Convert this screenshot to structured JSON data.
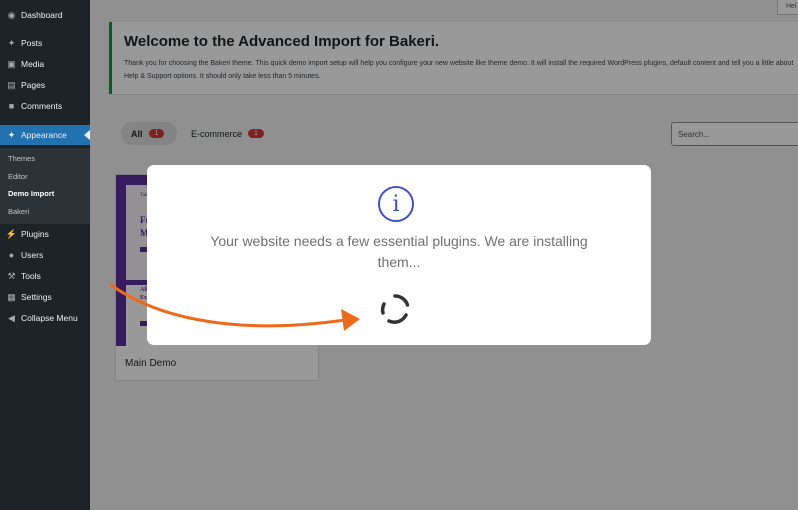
{
  "sidebar": {
    "items": [
      {
        "label": "Dashboard",
        "icon": "dashboard-icon"
      },
      {
        "label": "Posts",
        "icon": "pin-icon"
      },
      {
        "label": "Media",
        "icon": "media-icon"
      },
      {
        "label": "Pages",
        "icon": "pages-icon"
      },
      {
        "label": "Comments",
        "icon": "comments-icon"
      },
      {
        "label": "Appearance",
        "icon": "brush-icon"
      },
      {
        "label": "Plugins",
        "icon": "plug-icon"
      },
      {
        "label": "Users",
        "icon": "user-icon"
      },
      {
        "label": "Tools",
        "icon": "wrench-icon"
      },
      {
        "label": "Settings",
        "icon": "settings-icon"
      },
      {
        "label": "Collapse Menu",
        "icon": "collapse-icon"
      }
    ],
    "submenu": [
      "Themes",
      "Editor",
      "Demo Import",
      "Bakeri"
    ]
  },
  "help_tab": "Hel",
  "notice": {
    "title": "Welcome to the Advanced Import for Bakeri.",
    "text": "Thank you for choosing the Bakeri theme. This quick demo import setup will help you configure your new website like theme demo. It will install the required WordPress plugins, default content and tell you a little about Help & Support options. It should only take less than 5 minutes."
  },
  "filters": [
    {
      "label": "All",
      "count": "1"
    },
    {
      "label": "E-commerce",
      "count": "1"
    }
  ],
  "search": {
    "placeholder": "Search..."
  },
  "demo": {
    "name": "Main Demo",
    "thumb_small": "Take",
    "thumb_heading_1": "Fre",
    "thumb_heading_2": "Ma",
    "thumb_lower_1": "All",
    "thumb_lower_2": "Ex"
  },
  "modal": {
    "icon": "info-icon",
    "text": "Your website needs a few essential plugins. We are installing them..."
  },
  "colors": {
    "sidebar_bg": "#1d2327",
    "accent": "#2271b1",
    "notice_border": "#00a32a",
    "badge": "#d63638",
    "modal_icon": "#3f51c7",
    "arrow": "#ee6a1a"
  }
}
